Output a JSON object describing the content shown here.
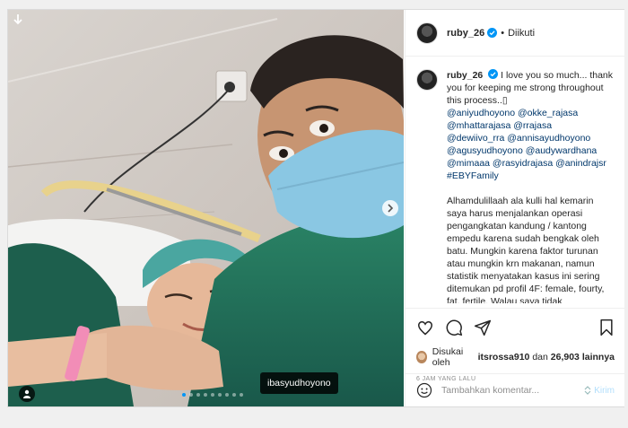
{
  "header": {
    "username": "ruby_26",
    "separator": "•",
    "follow_status": "Diikuti"
  },
  "caption": {
    "username": "ruby_26",
    "intro": "I love you so much... thank you for keeping me strong throughout this process..▯",
    "mentions_line1": "@aniyudhoyono @okke_rajasa",
    "mentions_line2": "@mhattarajasa @rrajasa",
    "mentions_line3": "@dewiivo_rra @annisayudhoyono",
    "mentions_line4": "@agusyudhoyono @audywardhana",
    "mentions_line5": "@mimaaa @rasyidrajasa @anindrajsr",
    "hashtag": "#EBYFamily",
    "body": "Alhamdulillaah ala kulli hal kemarin saya harus menjalankan operasi pengangkatan kandung / kantong empedu karena sudah bengkak oleh batu. Mungkin karena faktor turunan atau mungkin krn makanan, namun statistik menyatakan kasus ini sering ditemukan pd profil 4F: female, fourty, fat, fertile. Walau saya tidak"
  },
  "likes": {
    "prefix": "Disukai oleh",
    "user": "itsrossa910",
    "joiner": "dan",
    "count": "26,903",
    "suffix": "lainnya"
  },
  "timestamp": "6 JAM YANG LALU",
  "comment": {
    "placeholder": "Tambahkan komentar...",
    "send_label": "Kirim"
  },
  "photo": {
    "tag_label": "ibasyudhoyono",
    "carousel_total": 9,
    "carousel_active": 1
  },
  "colors": {
    "link": "#00376b",
    "verified": "#0095f6",
    "scrub_green": "#1f6e55",
    "cap_teal": "#4aa6a0",
    "mask_blue": "#8ac7e3"
  }
}
